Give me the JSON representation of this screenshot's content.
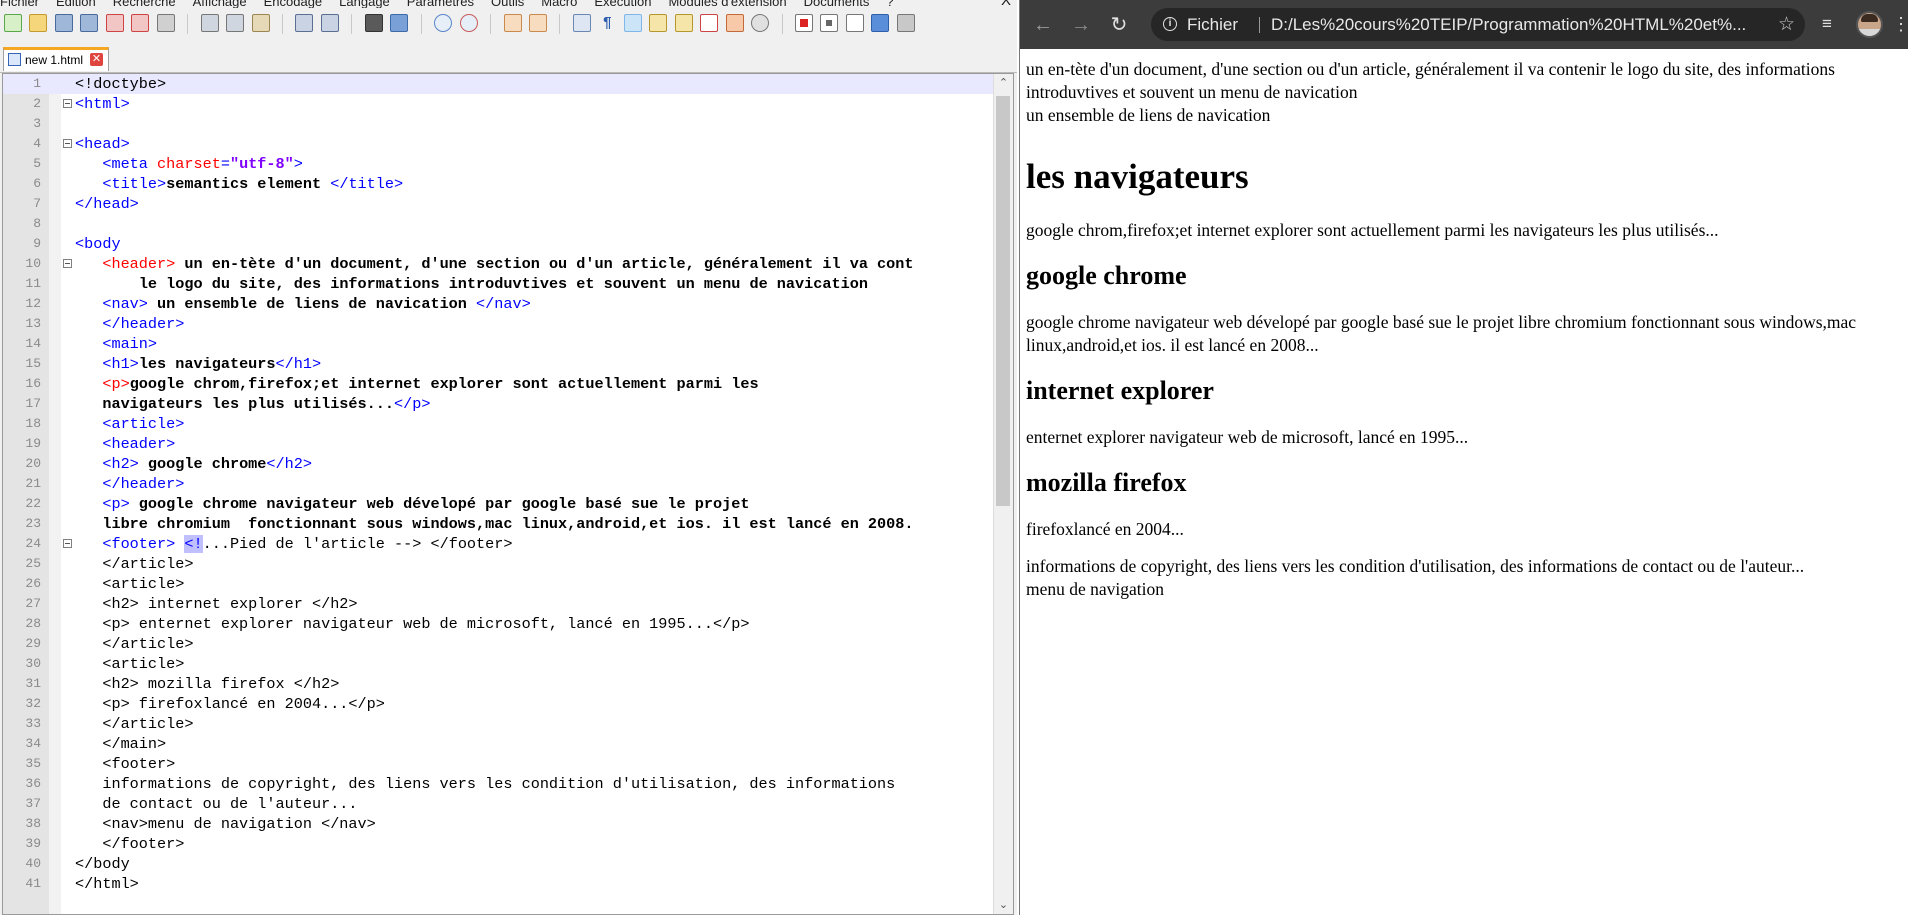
{
  "editor": {
    "menu": [
      "Fichier",
      "Édition",
      "Recherche",
      "Affichage",
      "Encodage",
      "Langage",
      "Paramètres",
      "Outils",
      "Macro",
      "Exécution",
      "Modules d'extension",
      "Documents",
      "?"
    ],
    "close_label": "X",
    "tab": {
      "label": "new 1.html",
      "close": "✕"
    },
    "scroll_up": "⌃",
    "scroll_down": "⌄",
    "lines": [
      {
        "n": "1",
        "html": "&lt;!doctybe&gt;"
      },
      {
        "n": "2",
        "html": "<span class='t'>&lt;html&gt;</span>"
      },
      {
        "n": "3",
        "html": ""
      },
      {
        "n": "4",
        "html": "<span class='t'>&lt;head&gt;</span>"
      },
      {
        "n": "5",
        "html": "   <span class='t'>&lt;meta </span><span class='a'>charset</span><span class='t'>=</span><span class='v'>\"utf-8\"</span><span class='t'>&gt;</span>"
      },
      {
        "n": "6",
        "html": "   <span class='t'>&lt;title&gt;</span><span class='b'>semantics element </span><span class='t'>&lt;/title&gt;</span>"
      },
      {
        "n": "7",
        "html": "<span class='t'>&lt;/head&gt;</span>"
      },
      {
        "n": "8",
        "html": ""
      },
      {
        "n": "9",
        "html": "<span class='t'>&lt;body</span>"
      },
      {
        "n": "10",
        "html": "   <span class='a'>&lt;header&gt;</span><span class='b'> un en-tète d'un document, d'une section ou d'un article, généralement il va cont</span>"
      },
      {
        "n": "11",
        "html": "       <span class='b'>le logo du site, des informations introduvtives et souvent un menu de navication</span>"
      },
      {
        "n": "12",
        "html": "   <span class='t'>&lt;nav&gt;</span><span class='b'> un ensemble de liens de navication </span><span class='t'>&lt;/nav&gt;</span>"
      },
      {
        "n": "13",
        "html": "   <span class='t'>&lt;/header&gt;</span>"
      },
      {
        "n": "14",
        "html": "   <span class='t'>&lt;main&gt;</span>"
      },
      {
        "n": "15",
        "html": "   <span class='t'>&lt;h1&gt;</span><span class='b'>les navigateurs</span><span class='t'>&lt;/h1&gt;</span>"
      },
      {
        "n": "16",
        "html": "   <span class='a'>&lt;p&gt;</span><span class='b'>google chrom,firefox;et internet explorer sont actuellement parmi les</span>"
      },
      {
        "n": "17",
        "html": "   <span class='b'>navigateurs les plus utilisés...</span><span class='t'>&lt;/p&gt;</span>"
      },
      {
        "n": "18",
        "html": "   <span class='t'>&lt;article&gt;</span>"
      },
      {
        "n": "19",
        "html": "   <span class='t'>&lt;header&gt;</span>"
      },
      {
        "n": "20",
        "html": "   <span class='t'>&lt;h2&gt;</span><span class='b'> google chrome</span><span class='t'>&lt;/h2&gt;</span>"
      },
      {
        "n": "21",
        "html": "   <span class='t'>&lt;/header&gt;</span>"
      },
      {
        "n": "22",
        "html": "   <span class='t'>&lt;p&gt;</span><span class='b'> google chrome navigateur web dévelopé par google basé sue le projet</span>"
      },
      {
        "n": "23",
        "html": "   <span class='b'>libre chromium  fonctionnant sous windows,mac linux,android,et ios. il est lancé en 2008.</span>"
      },
      {
        "n": "24",
        "html": "   <span class='t'>&lt;footer&gt;</span> <span class='hl t'>&lt;!</span>...Pied de l'article --&gt; &lt;/footer&gt;"
      },
      {
        "n": "25",
        "html": "   &lt;/article&gt;"
      },
      {
        "n": "26",
        "html": "   &lt;article&gt;"
      },
      {
        "n": "27",
        "html": "   &lt;h2&gt; internet explorer &lt;/h2&gt;"
      },
      {
        "n": "28",
        "html": "   &lt;p&gt; enternet explorer navigateur web de microsoft, lancé en 1995...&lt;/p&gt;"
      },
      {
        "n": "29",
        "html": "   &lt;/article&gt;"
      },
      {
        "n": "30",
        "html": "   &lt;article&gt;"
      },
      {
        "n": "31",
        "html": "   &lt;h2&gt; mozilla firefox &lt;/h2&gt;"
      },
      {
        "n": "32",
        "html": "   &lt;p&gt; firefoxlancé en 2004...&lt;/p&gt;"
      },
      {
        "n": "33",
        "html": "   &lt;/article&gt;"
      },
      {
        "n": "34",
        "html": "   &lt;/main&gt;"
      },
      {
        "n": "35",
        "html": "   &lt;footer&gt;"
      },
      {
        "n": "36",
        "html": "   informations de copyright, des liens vers les condition d'utilisation, des informations"
      },
      {
        "n": "37",
        "html": "   de contact ou de l'auteur..."
      },
      {
        "n": "38",
        "html": "   &lt;nav&gt;menu de navigation &lt;/nav&gt;"
      },
      {
        "n": "39",
        "html": "   &lt;/footer&gt;"
      },
      {
        "n": "40",
        "html": "&lt;/body"
      },
      {
        "n": "41",
        "html": "&lt;/html&gt;"
      }
    ],
    "fold_lines": [
      "2",
      "4",
      "10",
      "24"
    ]
  },
  "browser": {
    "back": "←",
    "forward": "→",
    "reload": "↻",
    "info": "i",
    "protocol": "Fichier",
    "url": "D:/Les%20cours%20TEIP/Programmation%20HTML%20et%...",
    "star": "☆",
    "media": "≡",
    "menu": "⋮",
    "page": {
      "header_text": "un en-tète d'un document, d'une section ou d'un article, généralement il va contenir le logo du site, des informations introduvtives et souvent un menu de navication",
      "nav_text": "un ensemble de liens de navication",
      "h1": "les navigateurs",
      "intro": "google chrom,firefox;et internet explorer sont actuellement parmi les navigateurs les plus utilisés...",
      "h2_chrome": "google chrome",
      "p_chrome": "google chrome navigateur web dévelopé par google basé sue le projet libre chromium fonctionnant sous windows,mac linux,android,et ios. il est lancé en 2008...",
      "h2_ie": "internet explorer",
      "p_ie": "enternet explorer navigateur web de microsoft, lancé en 1995...",
      "h2_firefox": "mozilla firefox",
      "p_firefox": "firefoxlancé en 2004...",
      "footer_text": "informations de copyright, des liens vers les condition d'utilisation, des informations de contact ou de l'auteur...",
      "footer_nav": "menu de navigation"
    }
  }
}
